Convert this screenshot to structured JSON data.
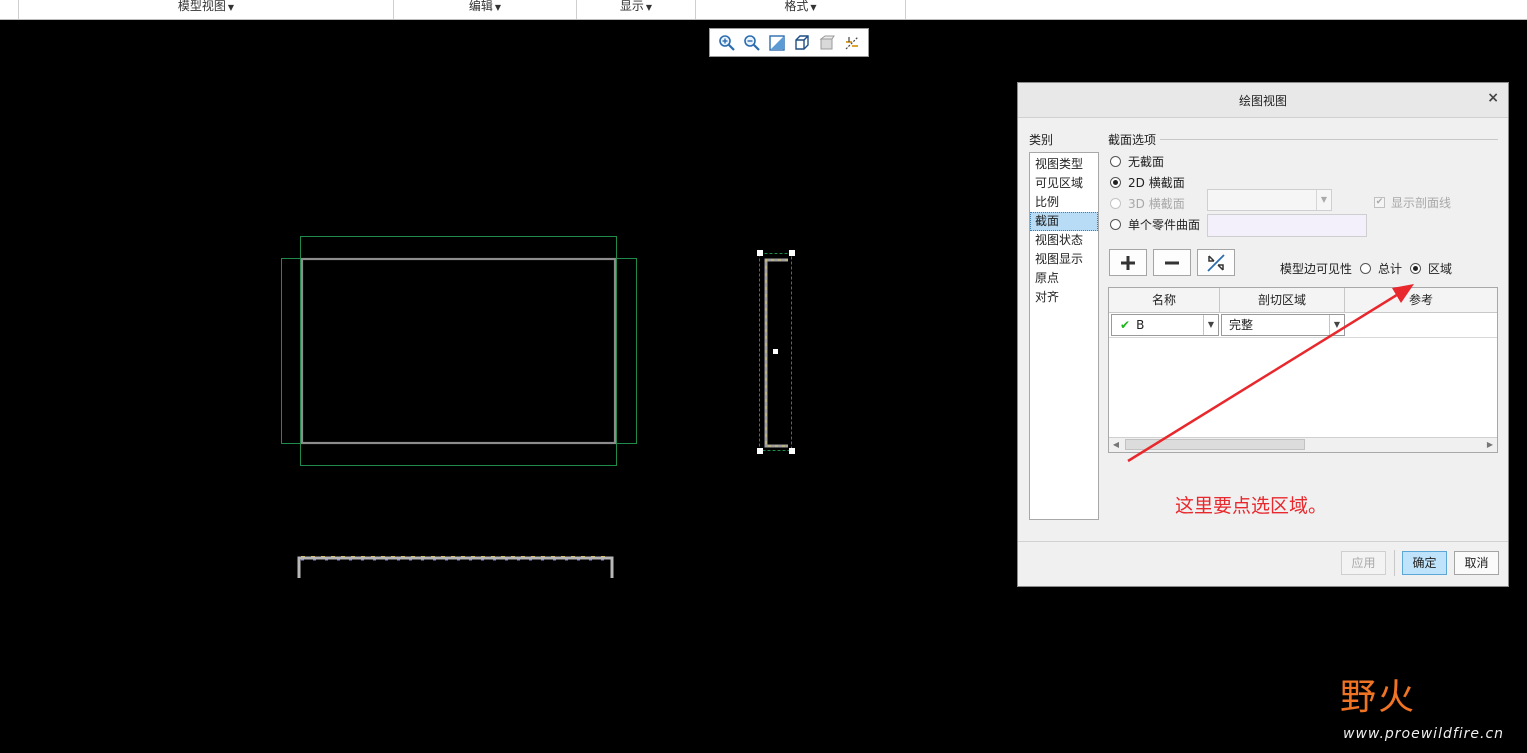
{
  "ribbon": {
    "groups": [
      {
        "label": "模型视图"
      },
      {
        "label": "编辑"
      },
      {
        "label": "显示"
      },
      {
        "label": "格式"
      }
    ]
  },
  "view_toolbar": {
    "icons": [
      "zoom-in-icon",
      "zoom-out-icon",
      "refit-icon",
      "display-style-icon",
      "view-manager-icon",
      "datum-display-icon"
    ]
  },
  "dialog": {
    "title": "绘图视图",
    "close": "×",
    "category_label": "类别",
    "categories": [
      "视图类型",
      "可见区域",
      "比例",
      "截面",
      "视图状态",
      "视图显示",
      "原点",
      "对齐"
    ],
    "selected_category": "截面",
    "section_options_label": "截面选项",
    "radios": [
      {
        "label": "无截面",
        "checked": false,
        "disabled": false
      },
      {
        "label": "2D 横截面",
        "checked": true,
        "disabled": false
      },
      {
        "label": "3D 横截面",
        "checked": false,
        "disabled": true
      },
      {
        "label": "单个零件曲面",
        "checked": false,
        "disabled": false
      }
    ],
    "show_hatch_label": "显示剖面线",
    "show_hatch_checked": true,
    "model_edge_visibility_label": "模型边可见性",
    "visibility_options": [
      {
        "label": "总计",
        "checked": false
      },
      {
        "label": "区域",
        "checked": true
      }
    ],
    "table": {
      "columns": [
        "名称",
        "剖切区域",
        "参考"
      ],
      "rows": [
        {
          "name": "B",
          "region": "完整",
          "reference": ""
        }
      ]
    },
    "annotation": "这里要点选区域。",
    "buttons": {
      "apply": "应用",
      "ok": "确定",
      "cancel": "取消"
    }
  },
  "watermark": {
    "logo_text": "野火",
    "url": "www.proewildfire.cn"
  },
  "colors": {
    "annotation_red": "#e8282c",
    "frame_green": "#1f8a4a",
    "selected_blue": "#b8dcf5",
    "watermark_orange": "#f07424"
  }
}
